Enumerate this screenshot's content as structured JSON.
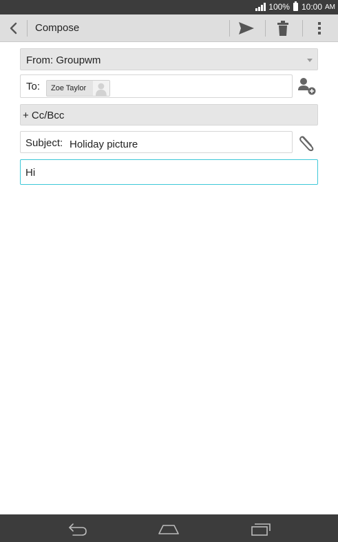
{
  "status_bar": {
    "battery": "100%",
    "time": "10:00",
    "ampm": "AM"
  },
  "action_bar": {
    "title": "Compose"
  },
  "from": {
    "label": "From:",
    "account": "Groupwm"
  },
  "to": {
    "label": "To:",
    "recipients": [
      {
        "name": "Zoe Taylor"
      }
    ]
  },
  "cc": {
    "label": "+ Cc/Bcc"
  },
  "subject": {
    "label": "Subject:",
    "value": "Holiday picture"
  },
  "body": {
    "value": "Hi"
  },
  "icons": {
    "back": "chevron-left-icon",
    "send": "send-icon",
    "delete": "trash-icon",
    "overflow": "more-vertical-icon",
    "add_contact": "add-contact-icon",
    "attach": "paperclip-icon",
    "nav_back": "back-arrow-icon",
    "nav_home": "home-icon",
    "nav_recent": "recent-apps-icon"
  },
  "colors": {
    "status_bar": "#3c3c3c",
    "action_bar": "#dedede",
    "focus_accent": "#3cc7d8",
    "nav_bar": "#3c3c3c"
  }
}
